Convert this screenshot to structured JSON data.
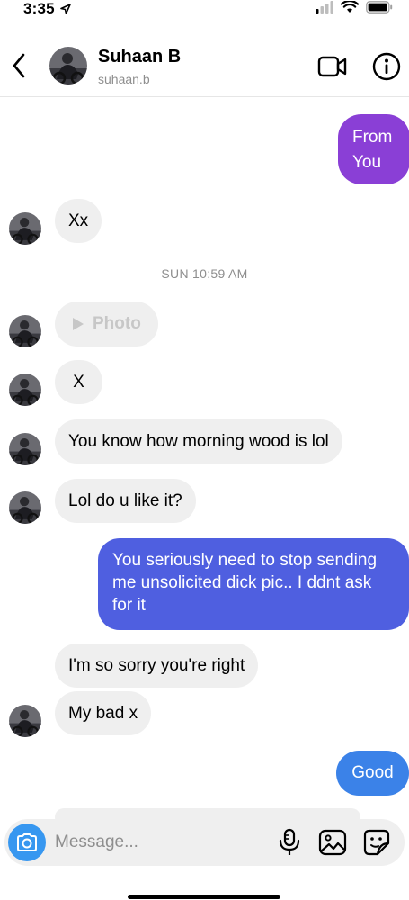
{
  "status_bar": {
    "time": "3:35"
  },
  "header": {
    "name": "Suhaan B",
    "username": "suhaan.b"
  },
  "timestamp": "SUN 10:59 AM",
  "messages": [
    {
      "text": "From\nYou",
      "dir": "out"
    },
    {
      "text": "Xx",
      "dir": "in"
    },
    {
      "text": "Photo",
      "dir": "in",
      "type": "photo"
    },
    {
      "text": "X",
      "dir": "in"
    },
    {
      "text": "You know how morning wood is lol",
      "dir": "in"
    },
    {
      "text": "Lol do u like it?",
      "dir": "in"
    },
    {
      "text": "You seriously need to stop sending me unsolicited dick pic.. I ddnt ask for it",
      "dir": "out"
    },
    {
      "text": "I'm so sorry you're right",
      "dir": "in"
    },
    {
      "text": "My bad x",
      "dir": "in"
    },
    {
      "text": "Good",
      "dir": "out"
    }
  ],
  "composer": {
    "placeholder": "Message..."
  },
  "colors": {
    "accent_blue": "#3797f0",
    "gradient_purple": "#8a3fd6",
    "gradient_indigo": "#4f5fe0",
    "incoming_bubble": "#efefef",
    "muted_text": "#8e8e8e"
  },
  "icons": [
    "back-chevron-icon",
    "video-call-icon",
    "info-icon",
    "camera-icon",
    "microphone-icon",
    "gallery-icon",
    "sticker-icon",
    "play-icon"
  ]
}
